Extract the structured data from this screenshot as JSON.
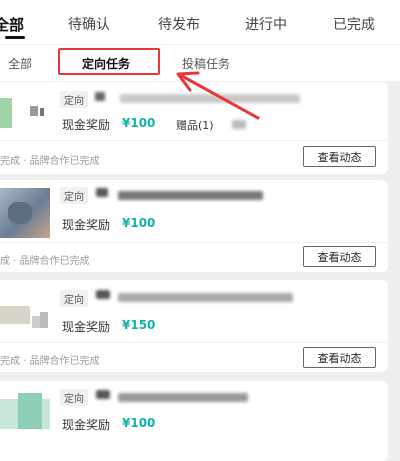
{
  "status_tabs": [
    {
      "label": "全部",
      "active": true
    },
    {
      "label": "待确认",
      "active": false
    },
    {
      "label": "待发布",
      "active": false
    },
    {
      "label": "进行中",
      "active": false
    },
    {
      "label": "已完成",
      "active": false
    }
  ],
  "sub_tabs": [
    {
      "label": "全部",
      "active": false
    },
    {
      "label": "定向任务",
      "active": true
    },
    {
      "label": "投稿任务",
      "active": false
    }
  ],
  "cards": [
    {
      "tag": "定向",
      "reward_label": "现金奖励",
      "reward_amount": "¥100",
      "gift": "赠品(1)",
      "status": "完成 · 品牌合作已完成",
      "button": "查看动态"
    },
    {
      "tag": "定向",
      "reward_label": "现金奖励",
      "reward_amount": "¥100",
      "status": "成 · 品牌合作已完成",
      "button": "查看动态"
    },
    {
      "tag": "定向",
      "reward_label": "现金奖励",
      "reward_amount": "¥150",
      "status": "完成 · 品牌合作已完成",
      "button": "查看动态"
    },
    {
      "tag": "定向",
      "reward_label": "现金奖励",
      "reward_amount": "¥100"
    }
  ],
  "colors": {
    "accent": "#11b3a8",
    "highlight": "#e8363b"
  }
}
